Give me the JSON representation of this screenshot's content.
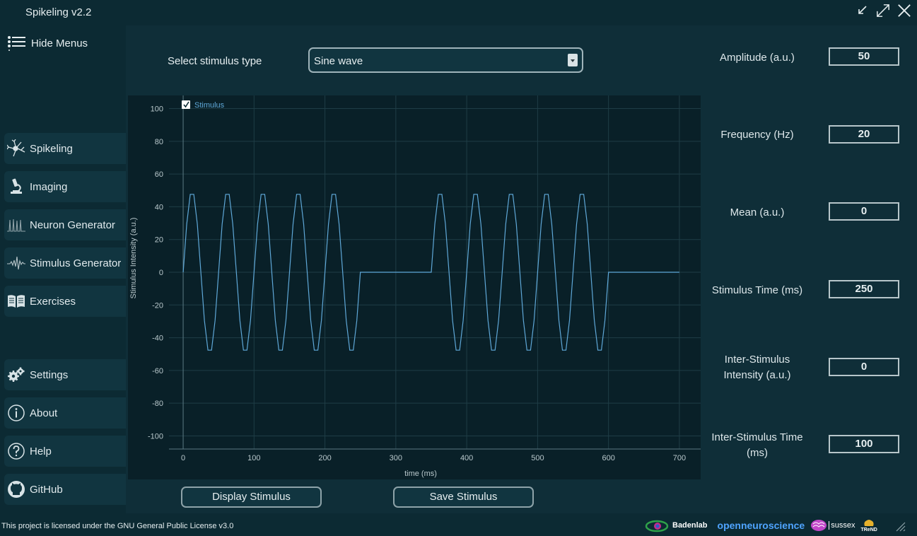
{
  "window": {
    "title": "Spikeling v2.2"
  },
  "sidebar": {
    "hide_menus": "Hide Menus",
    "items": [
      {
        "label": "Spikeling",
        "icon": "neuron-icon"
      },
      {
        "label": "Imaging",
        "icon": "microscope-icon"
      },
      {
        "label": "Neuron Generator",
        "icon": "spike-train-icon"
      },
      {
        "label": "Stimulus Generator",
        "icon": "waveform-icon"
      },
      {
        "label": "Exercises",
        "icon": "book-icon"
      },
      {
        "label": "Settings",
        "icon": "gears-icon"
      },
      {
        "label": "About",
        "icon": "info-icon"
      },
      {
        "label": "Help",
        "icon": "question-icon"
      },
      {
        "label": "GitHub",
        "icon": "github-icon"
      }
    ]
  },
  "stimulus": {
    "select_label": "Select stimulus type",
    "selected": "Sine wave"
  },
  "buttons": {
    "display": "Display Stimulus",
    "save": "Save Stimulus"
  },
  "params": {
    "amplitude_label": "Amplitude (a.u.)",
    "amplitude": "50",
    "frequency_label": "Frequency (Hz)",
    "frequency": "20",
    "mean_label": "Mean (a.u.)",
    "mean": "0",
    "stim_time_label": "Stimulus Time (ms)",
    "stim_time": "250",
    "isi_intensity_label_1": "Inter-Stimulus",
    "isi_intensity_label_2": "Intensity (a.u.)",
    "isi_intensity": "0",
    "isi_time_label_1": "Inter-Stimulus Time",
    "isi_time_label_2": "(ms)",
    "isi_time": "100"
  },
  "footer": {
    "license": "This project is licensed under the GNU General Public License v3.0",
    "logos": [
      "Badenlab",
      "openneuroscience",
      "sussex",
      "TReND"
    ]
  },
  "colors": {
    "accent": "#5fa8d8",
    "background": "#0c2a33",
    "panel": "#0f2e38",
    "plot_bg": "#092028"
  },
  "chart_data": {
    "type": "line",
    "series": [
      {
        "name": "Stimulus",
        "x": [
          0,
          5,
          10,
          15,
          20,
          25,
          30,
          35,
          40,
          45,
          50,
          55,
          60,
          65,
          70,
          75,
          80,
          85,
          90,
          95,
          100,
          105,
          110,
          115,
          120,
          125,
          130,
          135,
          140,
          145,
          150,
          155,
          160,
          165,
          170,
          175,
          180,
          185,
          190,
          195,
          200,
          205,
          210,
          215,
          220,
          225,
          230,
          235,
          240,
          245,
          250,
          250,
          350,
          350,
          355,
          360,
          365,
          370,
          375,
          380,
          385,
          390,
          395,
          400,
          405,
          410,
          415,
          420,
          425,
          430,
          435,
          440,
          445,
          450,
          455,
          460,
          465,
          470,
          475,
          480,
          485,
          490,
          495,
          500,
          505,
          510,
          515,
          520,
          525,
          530,
          535,
          540,
          545,
          550,
          555,
          560,
          565,
          570,
          575,
          580,
          585,
          590,
          595,
          600,
          600,
          700
        ],
        "y": [
          0,
          29.4,
          47.6,
          47.6,
          29.4,
          0,
          -29.4,
          -47.6,
          -47.6,
          -29.4,
          0,
          29.4,
          47.6,
          47.6,
          29.4,
          0,
          -29.4,
          -47.6,
          -47.6,
          -29.4,
          0,
          29.4,
          47.6,
          47.6,
          29.4,
          0,
          -29.4,
          -47.6,
          -47.6,
          -29.4,
          0,
          29.4,
          47.6,
          47.6,
          29.4,
          0,
          -29.4,
          -47.6,
          -47.6,
          -29.4,
          0,
          29.4,
          47.6,
          47.6,
          29.4,
          0,
          -29.4,
          -47.6,
          -47.6,
          -29.4,
          0,
          0,
          0,
          0,
          29.4,
          47.6,
          47.6,
          29.4,
          0,
          -29.4,
          -47.6,
          -47.6,
          -29.4,
          0,
          29.4,
          47.6,
          47.6,
          29.4,
          0,
          -29.4,
          -47.6,
          -47.6,
          -29.4,
          0,
          29.4,
          47.6,
          47.6,
          29.4,
          0,
          -29.4,
          -47.6,
          -47.6,
          -29.4,
          0,
          29.4,
          47.6,
          47.6,
          29.4,
          0,
          -29.4,
          -47.6,
          -47.6,
          -29.4,
          0,
          29.4,
          47.6,
          47.6,
          29.4,
          0,
          -29.4,
          -47.6,
          -47.6,
          -29.4,
          0,
          0,
          0
        ]
      }
    ],
    "xlabel": "time (ms)",
    "ylabel": "Stimulus Intensity (a.u.)",
    "xlim": [
      -20,
      730
    ],
    "ylim": [
      -108,
      108
    ],
    "xticks": [
      0,
      100,
      200,
      300,
      400,
      500,
      600,
      700
    ],
    "yticks": [
      100,
      80,
      60,
      40,
      20,
      0,
      -20,
      -40,
      -60,
      -80,
      -100
    ],
    "grid": true,
    "legend": "top-left"
  }
}
